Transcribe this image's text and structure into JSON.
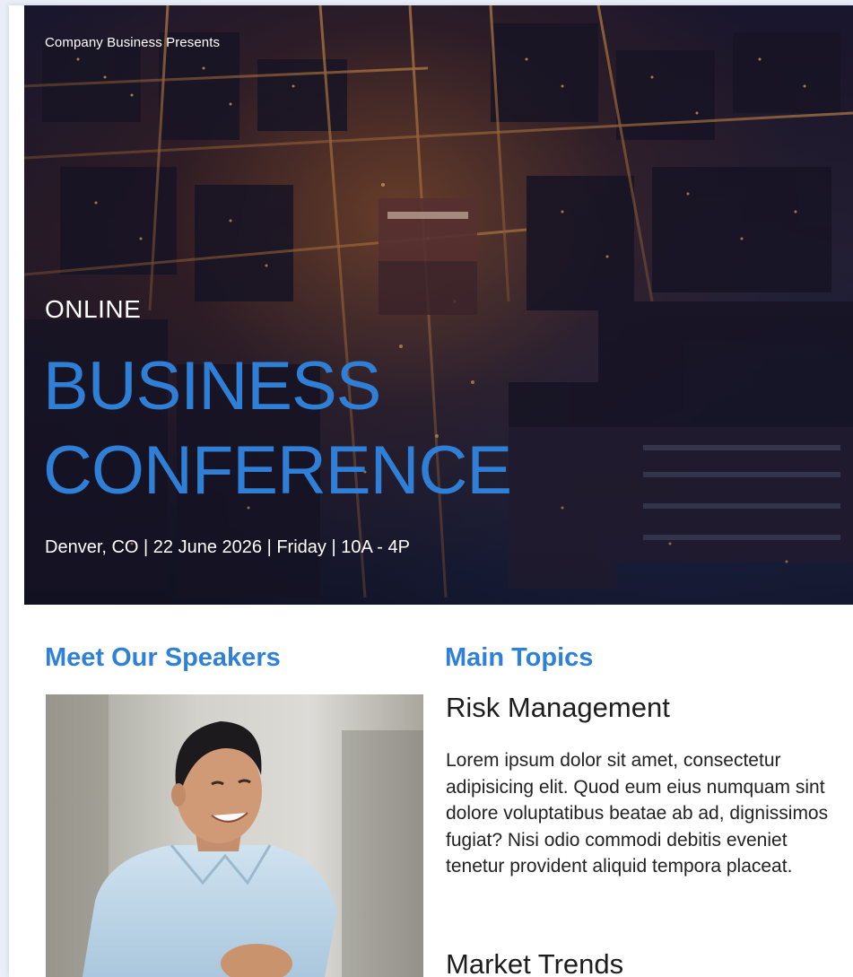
{
  "hero": {
    "presenter": "Company Business Presents",
    "format": "ONLINE",
    "title_line1": "BUSINESS",
    "title_line2": "CONFERENCE",
    "details": "Denver, CO | 22 June 2026 | Friday | 10A - 4P",
    "title_color": "#2f7fd6",
    "image": "aerial-night-city-photo"
  },
  "speakers": {
    "heading": "Meet Our Speakers",
    "photo": "speaker-portrait-photo"
  },
  "topics": {
    "heading": "Main Topics",
    "items": [
      {
        "title": "Risk Management",
        "body": "Lorem ipsum dolor sit amet, consectetur adipisicing elit. Quod eum eius numquam sint dolore voluptatibus beatae ab ad, dignissimos fugiat? Nisi odio commodi debitis eveniet tenetur provident aliquid tempora placeat."
      },
      {
        "title": "Market Trends"
      }
    ]
  },
  "colors": {
    "accent": "#2f80d8",
    "background": "#e9eef8"
  }
}
